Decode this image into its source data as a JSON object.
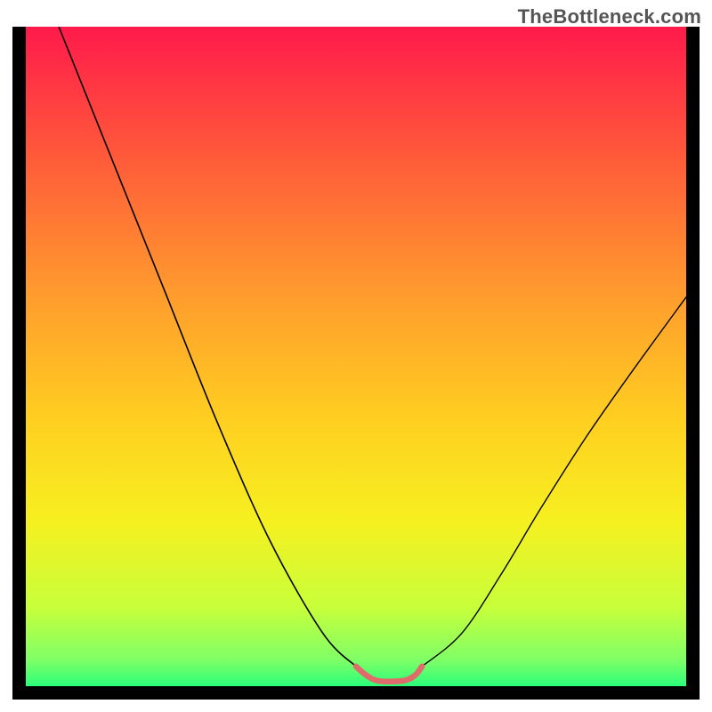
{
  "watermark": "TheBottleneck.com",
  "chart_data": {
    "type": "line",
    "title": "",
    "xlabel": "",
    "ylabel": "",
    "xlim": [
      0,
      100
    ],
    "ylim": [
      0,
      100
    ],
    "grid": false,
    "legend": false,
    "background_gradient": {
      "direction": "vertical",
      "stops": [
        {
          "pos": 0.0,
          "color": "#ff1a4b"
        },
        {
          "pos": 0.2,
          "color": "#ff5b3a"
        },
        {
          "pos": 0.4,
          "color": "#ff9a2e"
        },
        {
          "pos": 0.6,
          "color": "#ffd020"
        },
        {
          "pos": 0.75,
          "color": "#f6f020"
        },
        {
          "pos": 0.88,
          "color": "#c8ff3a"
        },
        {
          "pos": 0.96,
          "color": "#7fff66"
        },
        {
          "pos": 1.0,
          "color": "#2bff7a"
        }
      ]
    },
    "series": [
      {
        "name": "left_arm",
        "stroke": "#000000",
        "stroke_width": 1.6,
        "x": [
          5,
          13,
          21,
          29,
          37,
          45,
          50
        ],
        "y": [
          100,
          80,
          60,
          40,
          22,
          8,
          3
        ]
      },
      {
        "name": "right_arm",
        "stroke": "#000000",
        "stroke_width": 1.4,
        "x": [
          60,
          66,
          72,
          78,
          85,
          92,
          100
        ],
        "y": [
          3,
          8,
          17,
          27,
          38,
          48,
          59
        ]
      },
      {
        "name": "optimal_zone_marker",
        "stroke": "#e06b6b",
        "stroke_width": 6.5,
        "x": [
          50,
          51.5,
          53,
          55,
          57.5,
          59,
          60
        ],
        "y": [
          3,
          1.7,
          0.9,
          0.7,
          0.9,
          1.7,
          3
        ]
      }
    ],
    "frame": {
      "top": false,
      "right": true,
      "bottom": true,
      "left": true,
      "thickness_px": 15,
      "color": "#000000"
    }
  }
}
